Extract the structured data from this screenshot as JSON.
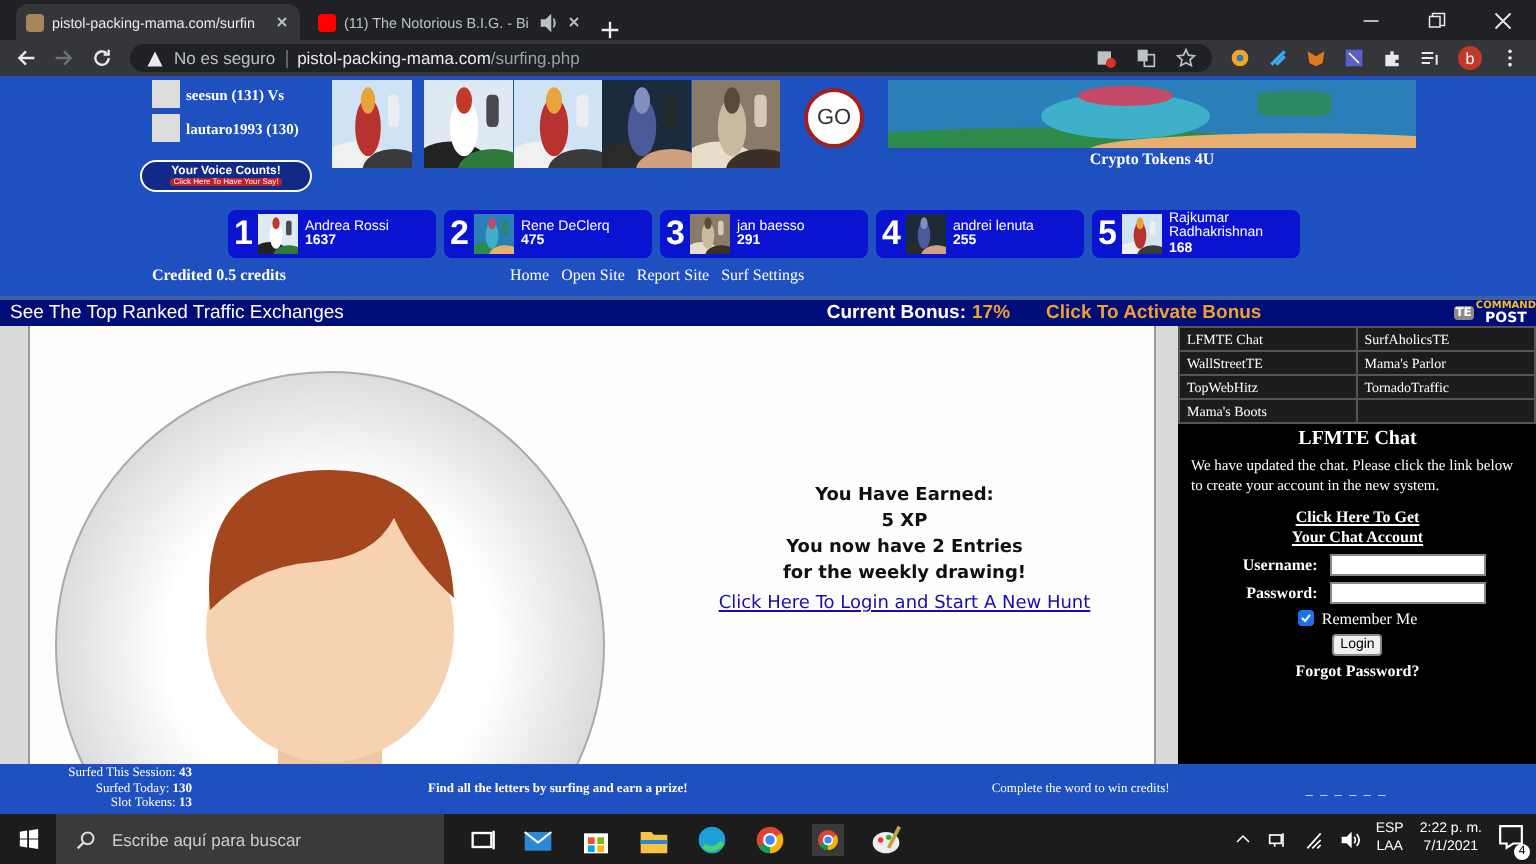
{
  "browser": {
    "tabs": [
      {
        "title": "pistol-packing-mama.com/surfin",
        "selected": true,
        "audio": false
      },
      {
        "title": "(11) The Notorious B.I.G. - Bi",
        "selected": false,
        "audio": true
      }
    ],
    "address": {
      "security": "No es seguro",
      "domain": "pistol-packing-mama.com",
      "path": "/surfing.php"
    },
    "profile_initial": "b"
  },
  "header": {
    "versus": [
      "seesun (131) Vs",
      "lautaro1993 (130)"
    ],
    "voice_badge": {
      "title": "Your Voice Counts!",
      "subtitle": "Click Here To Have Your Say!"
    },
    "go_button": "GO",
    "banner_caption": "Crypto Tokens 4U",
    "leaders": [
      {
        "rank": "1",
        "name": "Andrea Rossi",
        "score": "1637"
      },
      {
        "rank": "2",
        "name": "Rene DeClerq",
        "score": "475"
      },
      {
        "rank": "3",
        "name": "jan baesso",
        "score": "291"
      },
      {
        "rank": "4",
        "name": "andrei lenuta",
        "score": "255"
      },
      {
        "rank": "5",
        "name": "Rajkumar Radhakrishnan",
        "score": "168"
      }
    ],
    "credited": "Credited 0.5 credits",
    "nav": [
      "Home",
      "Open Site",
      "Report Site",
      "Surf Settings"
    ]
  },
  "ticker": {
    "link": "See The Top Ranked Traffic Exchanges",
    "bonus_label": "Current Bonus:",
    "bonus_value": "17%",
    "activate": "Click To Activate Bonus",
    "logo": {
      "badge": "TE",
      "top": "COMMAND",
      "bottom": "POST"
    }
  },
  "reward": {
    "lines": [
      "You Have Earned:",
      "5 XP",
      "You now have 2 Entries",
      "for the weekly drawing!"
    ],
    "link": "Click Here To Login and Start A New Hunt"
  },
  "sidebar": {
    "sites": [
      [
        "LFMTE Chat",
        "SurfAholicsTE"
      ],
      [
        "WallStreetTE",
        "Mama's Parlor"
      ],
      [
        "TopWebHitz",
        "TornadoTraffic"
      ],
      [
        "Mama's Boots"
      ]
    ],
    "chat": {
      "title": "LFMTE Chat",
      "message": "We have updated the chat. Please click the link below to create your account in the new system.",
      "link_lines": [
        "Click Here To Get",
        "Your Chat Account"
      ],
      "username_label": "Username:",
      "password_label": "Password:",
      "remember": {
        "label": "Remember Me",
        "checked": true
      },
      "login": "Login",
      "forgot": "Forgot Password?"
    }
  },
  "status": {
    "stats": [
      {
        "label": "Surfed This Session:",
        "value": "43"
      },
      {
        "label": "Surfed Today:",
        "value": "130"
      },
      {
        "label": "Slot Tokens:",
        "value": "13"
      }
    ],
    "hint": "Find all the letters by surfing and earn a prize!",
    "goal": "Complete the word to win credits!",
    "word": "_ _ _ _  _ _"
  },
  "taskbar": {
    "search_placeholder": "Escribe aquí para buscar",
    "lang": "ESP",
    "layout": "LAA",
    "time": "2:22 p. m.",
    "date": "7/1/2021",
    "notifications": "4"
  }
}
